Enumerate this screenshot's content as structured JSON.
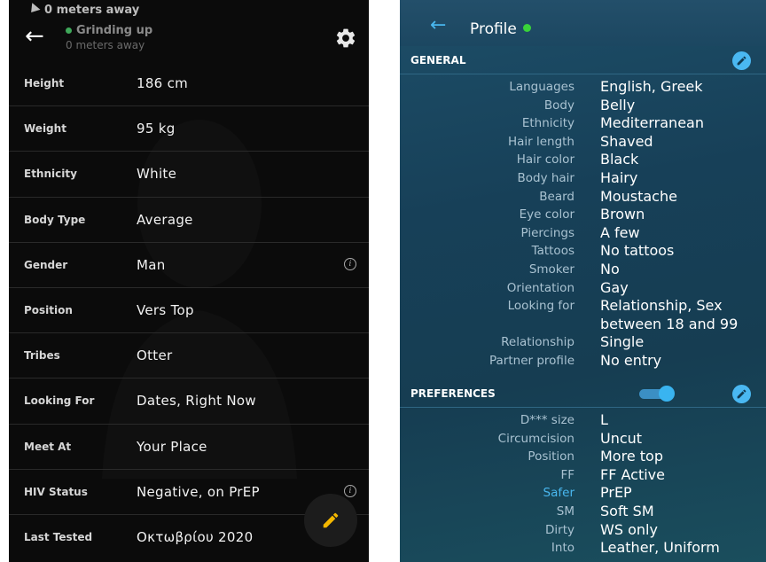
{
  "left_panel": {
    "status_distance": "0 meters away",
    "activity": "Grinding up",
    "distance_sub": "0 meters away",
    "rows": [
      {
        "label": "Height",
        "value": "186 cm",
        "info": false
      },
      {
        "label": "Weight",
        "value": "95 kg",
        "info": false
      },
      {
        "label": "Ethnicity",
        "value": "White",
        "info": false
      },
      {
        "label": "Body Type",
        "value": "Average",
        "info": false
      },
      {
        "label": "Gender",
        "value": "Man",
        "info": true
      },
      {
        "label": "Position",
        "value": "Vers Top",
        "info": false
      },
      {
        "label": "Tribes",
        "value": "Otter",
        "info": false
      },
      {
        "label": "Looking For",
        "value": "Dates, Right Now",
        "info": false
      },
      {
        "label": "Meet At",
        "value": "Your Place",
        "info": false
      },
      {
        "label": "HIV Status",
        "value": "Negative, on PrEP",
        "info": true
      },
      {
        "label": "Last Tested",
        "value": "Οκτωβρίου 2020",
        "info": false
      }
    ]
  },
  "right_panel": {
    "title": "Profile",
    "general": {
      "title": "GENERAL",
      "rows": [
        {
          "label": "Languages",
          "value": "English, Greek"
        },
        {
          "label": "Body",
          "value": "Belly"
        },
        {
          "label": "Ethnicity",
          "value": "Mediterranean"
        },
        {
          "label": "Hair length",
          "value": "Shaved"
        },
        {
          "label": "Hair color",
          "value": "Black"
        },
        {
          "label": "Body hair",
          "value": "Hairy"
        },
        {
          "label": "Beard",
          "value": "Moustache"
        },
        {
          "label": "Eye color",
          "value": "Brown"
        },
        {
          "label": "Piercings",
          "value": "A few"
        },
        {
          "label": "Tattoos",
          "value": "No tattoos"
        },
        {
          "label": "Smoker",
          "value": "No"
        },
        {
          "label": "Orientation",
          "value": "Gay"
        },
        {
          "label": "Looking for",
          "value": "Relationship, Sex between 18 and 99"
        },
        {
          "label": "Relationship",
          "value": "Single"
        },
        {
          "label": "Partner profile",
          "value": "No entry"
        }
      ]
    },
    "preferences": {
      "title": "PREFERENCES",
      "toggle_on": true,
      "rows": [
        {
          "label": "D*** size",
          "value": "L"
        },
        {
          "label": "Circumcision",
          "value": "Uncut"
        },
        {
          "label": "Position",
          "value": "More top"
        },
        {
          "label": "FF",
          "value": "FF Active"
        },
        {
          "label": "Safer",
          "value": "PrEP",
          "highlight": true
        },
        {
          "label": "SM",
          "value": "Soft SM"
        },
        {
          "label": "Dirty",
          "value": "WS only"
        },
        {
          "label": "Into",
          "value": "Leather, Uniform"
        }
      ]
    }
  },
  "colors": {
    "left_bg": "#0b0b0b",
    "right_bg": "#174058",
    "accent_blue": "#49b7ef",
    "online_green": "#39d339",
    "fab_pencil": "#f5b800"
  }
}
